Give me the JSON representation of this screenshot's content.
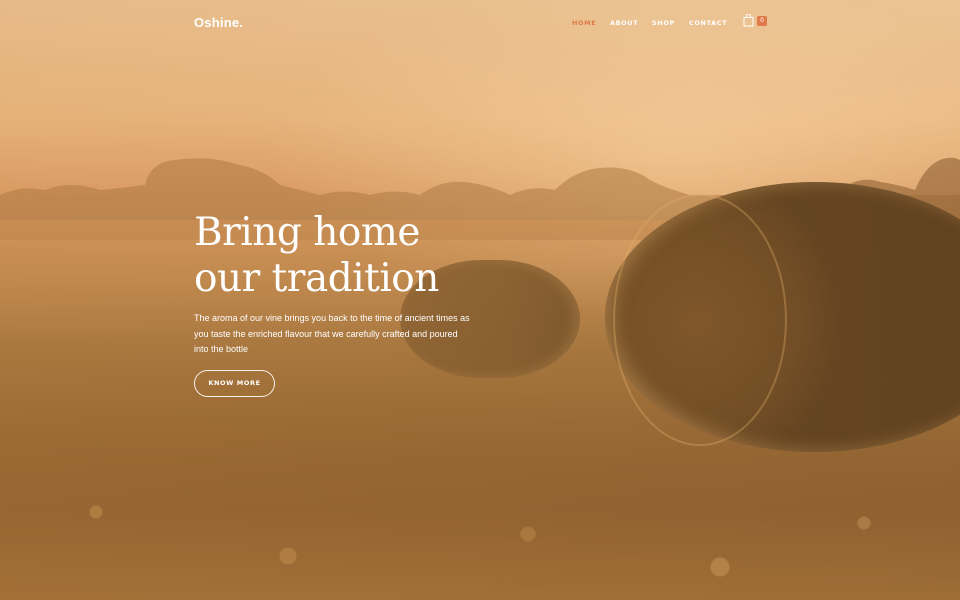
{
  "header": {
    "logo": "Oshine.",
    "nav": [
      {
        "label": "HOME",
        "active": true
      },
      {
        "label": "ABOUT",
        "active": false
      },
      {
        "label": "SHOP",
        "active": false
      },
      {
        "label": "CONTACT",
        "active": false
      }
    ],
    "cart": {
      "icon": "shopping-bag-icon",
      "count": "0"
    }
  },
  "hero": {
    "headline_line1": "Bring home",
    "headline_line2": "our tradition",
    "subtext": "The aroma of our vine brings you back to the time of ancient times as you taste the enriched flavour that we carefully crafted and poured into the bottle",
    "cta_label": "KNOW MORE"
  },
  "colors": {
    "accent": "#e07a4a",
    "text": "#ffffff"
  }
}
